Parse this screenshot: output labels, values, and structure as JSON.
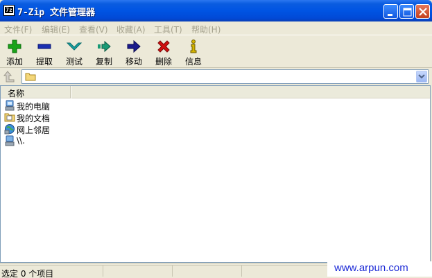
{
  "window": {
    "title": "7-Zip 文件管理器",
    "icon": "7z-app-icon"
  },
  "menu": [
    {
      "label": "文件(F)"
    },
    {
      "label": "编辑(E)"
    },
    {
      "label": "查看(V)"
    },
    {
      "label": "收藏(A)"
    },
    {
      "label": "工具(T)"
    },
    {
      "label": "帮助(H)"
    }
  ],
  "toolbar": [
    {
      "label": "添加",
      "icon": "plus-icon",
      "color": "#1aa31a"
    },
    {
      "label": "提取",
      "icon": "minus-icon",
      "color": "#1a2fb0"
    },
    {
      "label": "测试",
      "icon": "check-icon",
      "color": "#17a3a3"
    },
    {
      "label": "复制",
      "icon": "copy-arrow-icon",
      "color": "#199a75"
    },
    {
      "label": "移动",
      "icon": "move-arrow-icon",
      "color": "#1a1a8c"
    },
    {
      "label": "删除",
      "icon": "delete-x-icon",
      "color": "#d01010"
    },
    {
      "label": "信息",
      "icon": "info-icon",
      "color": "#d4b400"
    }
  ],
  "address": {
    "value": ""
  },
  "list": {
    "columns": [
      "名称"
    ],
    "items": [
      {
        "name": "我的电脑",
        "icon": "computer-icon"
      },
      {
        "name": "我的文档",
        "icon": "documents-folder-icon"
      },
      {
        "name": "网上邻居",
        "icon": "network-icon"
      },
      {
        "name": "\\\\.",
        "icon": "drive-icon"
      }
    ]
  },
  "status": {
    "selection": "选定 0 个项目"
  },
  "watermark": "www.arpun.com"
}
